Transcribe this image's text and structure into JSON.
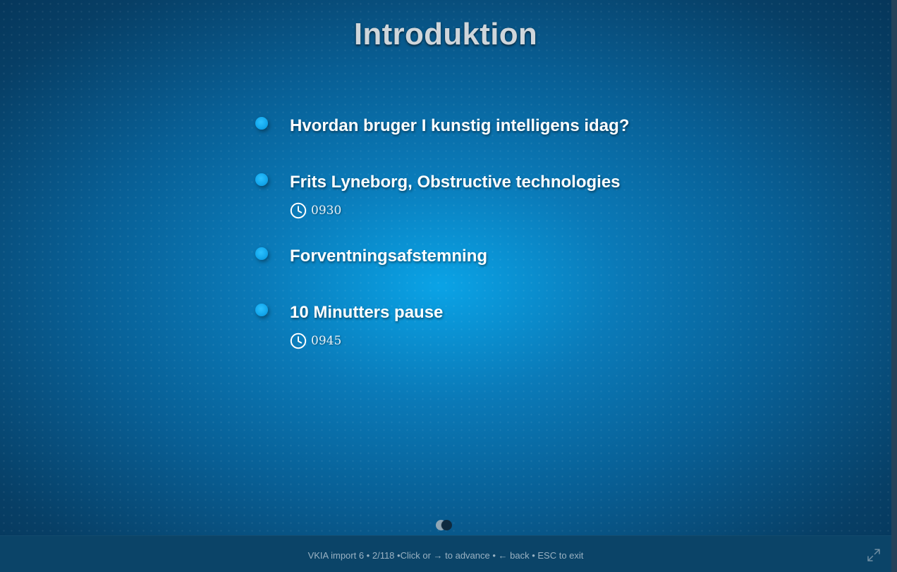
{
  "slide": {
    "title": "Introduktion"
  },
  "agenda": {
    "items": [
      {
        "label": "Hvordan bruger I kunstig intelligens idag?"
      },
      {
        "label": "Frits Lyneborg, Obstructive technologies",
        "time": "0930"
      },
      {
        "label": "Forventningsafstemning"
      },
      {
        "label": "10 Minutters pause",
        "time": "0945"
      }
    ]
  },
  "footer": {
    "text": "VKIA import 6 • 2/118 •Click or → to advance • ← back • ESC to exit"
  },
  "icons": {
    "bullet": "bullet-dot-icon",
    "clock": "clock-icon",
    "fullscreen": "fullscreen-expand-icon",
    "nav": "slide-nav-toggle-icon"
  },
  "colors": {
    "background_center": "#0aa3e6",
    "background_edge": "#073f66",
    "bullet": "#12a6ec",
    "title": "#cfd6db",
    "footer_bg": "#0b4468",
    "footer_text": "#9ab2c3"
  }
}
